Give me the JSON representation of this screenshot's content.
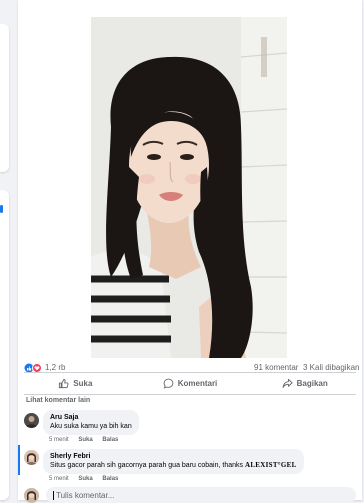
{
  "top_bar": {
    "more_label": "···"
  },
  "post": {
    "photo": {
      "alt_icon": "portrait-photo"
    },
    "stats": {
      "reactions": "1,2 rb",
      "comments": "91 komentar",
      "shares": "3 Kali dibagikan"
    },
    "actions": [
      {
        "label": "Suka",
        "icon": "like-icon"
      },
      {
        "label": "Komentari",
        "icon": "comment-icon"
      },
      {
        "label": "Bagikan",
        "icon": "share-icon"
      }
    ]
  },
  "comments_section": {
    "more_label": "Lihat komentar lain",
    "comments": [
      {
        "author": "Aru Saja",
        "text": "Aku suka kamu ya bih kan",
        "time": "5 menit",
        "like": "Suka",
        "reply": "Balas"
      },
      {
        "author": "Sherly Febri",
        "text_prefix": "Situs gacor parah sih gacornya parah gua baru cobain, thanks",
        "brand": "ALEXIST°GEL",
        "time": "5 menit",
        "like": "Suka",
        "reply": "Balas"
      }
    ],
    "composer_placeholder": "Tulis komentar..."
  },
  "colors": {
    "accent": "#1877f2",
    "reaction_love": "#f33e58",
    "bubble": "#f0f2f5",
    "secondary_text": "#65676b"
  }
}
